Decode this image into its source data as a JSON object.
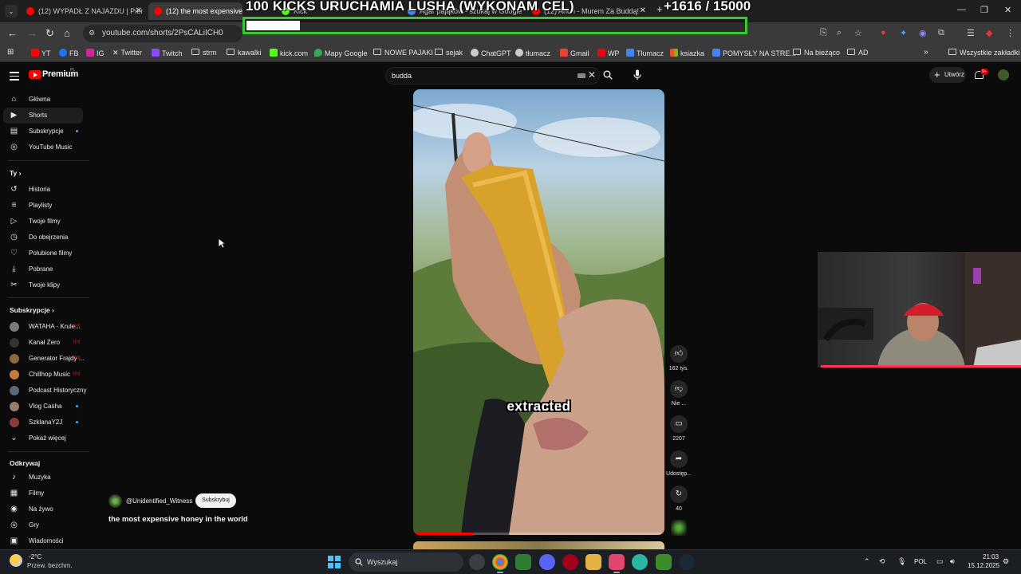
{
  "browser": {
    "tabs": [
      {
        "label": "(12) WYPADŁ Z NAJAZDU | Pier",
        "color": "#ff0000"
      },
      {
        "label": "(12) the most expensive ho",
        "color": "#ff0000",
        "active": true
      },
      {
        "label": "Kick",
        "color": "#53fc18"
      },
      {
        "label": "Agar pająków - szukaj w Google",
        "color": "#4285f4"
      },
      {
        "label": "(12) Anon - Murem Za Buddą!",
        "color": "#ff0000"
      }
    ],
    "url": "youtube.com/shorts/2PsCALiICH0",
    "bookmarks": [
      {
        "label": "YT",
        "icon": "youtube-icon",
        "color": "#ff0000"
      },
      {
        "label": "FB",
        "icon": "facebook-icon",
        "color": "#1877f2"
      },
      {
        "label": "IG",
        "icon": "instagram-icon",
        "color": "#d6249f"
      },
      {
        "label": "Twitter",
        "icon": "x-icon",
        "color": "#ffffff"
      },
      {
        "label": "Twitch",
        "icon": "twitch-icon",
        "color": "#9146ff"
      },
      {
        "label": "strm",
        "icon": "folder-icon"
      },
      {
        "label": "kawalki",
        "icon": "folder-icon"
      },
      {
        "label": "kick.com",
        "icon": "kick-icon",
        "color": "#53fc18"
      },
      {
        "label": "Mapy Google",
        "icon": "maps-icon",
        "color": "#34a853"
      },
      {
        "label": "NOWE PAJAKI",
        "icon": "folder-icon"
      },
      {
        "label": "sejak",
        "icon": "folder-icon"
      },
      {
        "label": "ChatGPT",
        "icon": "chatgpt-icon",
        "color": "#cccccc"
      },
      {
        "label": "tłumacz",
        "icon": "globe-icon",
        "color": "#cccccc"
      },
      {
        "label": "Gmail",
        "icon": "gmail-icon",
        "color": "#ea4335"
      },
      {
        "label": "WP",
        "icon": "wp-icon",
        "color": "#e30613"
      },
      {
        "label": "Tłumacz",
        "icon": "translate-icon",
        "color": "#4285f4"
      },
      {
        "label": "ksiazka",
        "icon": "ms-icon",
        "color": "#f25022"
      },
      {
        "label": "POMYSŁY NA STRE...",
        "icon": "doc-icon",
        "color": "#4285f4"
      },
      {
        "label": "Na bieżąco",
        "icon": "folder-icon"
      },
      {
        "label": "AD",
        "icon": "folder-icon"
      }
    ],
    "all_bookmarks": "Wszystkie zakładki"
  },
  "overlay": {
    "title": "100 KICKS URUCHAMIA LUSHA (WYKONAM CEL)",
    "counter": "+1616   / 15000",
    "progress": 0.108,
    "color": "#39c734"
  },
  "youtube": {
    "logo": "Premium",
    "logo_country": "PL",
    "search_value": "budda",
    "create": "Utwórz",
    "notifications_badge": "9+",
    "nav_main": [
      {
        "label": "Główna",
        "icon": "home-icon"
      },
      {
        "label": "Shorts",
        "icon": "shorts-icon",
        "active": true
      },
      {
        "label": "Subskrypcje",
        "icon": "subscriptions-icon",
        "dot": true
      },
      {
        "label": "YouTube Music",
        "icon": "music-icon"
      }
    ],
    "you_header": "Ty",
    "nav_you": [
      {
        "label": "Historia",
        "icon": "history-icon"
      },
      {
        "label": "Playlisty",
        "icon": "playlist-icon"
      },
      {
        "label": "Twoje filmy",
        "icon": "video-icon"
      },
      {
        "label": "Do obejrzenia",
        "icon": "clock-icon"
      },
      {
        "label": "Polubione filmy",
        "icon": "like-icon"
      },
      {
        "label": "Pobrane",
        "icon": "download-icon"
      },
      {
        "label": "Twoje klipy",
        "icon": "scissors-icon"
      }
    ],
    "subs_header": "Subskrypcje",
    "subscriptions": [
      {
        "label": "WATAHA - Krule...",
        "color": "#7a7a7a",
        "live": true
      },
      {
        "label": "Kanał Zero",
        "color": "#222222",
        "live": true
      },
      {
        "label": "Generator Frajdy ...",
        "color": "#8a6a3a",
        "live": true
      },
      {
        "label": "Chillhop Music",
        "color": "#c97a3a",
        "live": true
      },
      {
        "label": "Podcast Historyczny",
        "color": "#5a6a7a",
        "live": false
      },
      {
        "label": "Vlog Casha",
        "color": "#9a7a6a",
        "dot": true
      },
      {
        "label": "SzklanaY2J",
        "color": "#8a3a3a",
        "dot": true
      }
    ],
    "show_more": "Pokaż więcej",
    "explore_header": "Odkrywaj",
    "explore": [
      {
        "label": "Muzyka",
        "icon": "music-note-icon"
      },
      {
        "label": "Filmy",
        "icon": "film-icon"
      },
      {
        "label": "Na żywo",
        "icon": "live-icon"
      },
      {
        "label": "Gry",
        "icon": "gamepad-icon"
      },
      {
        "label": "Wiadomości",
        "icon": "news-icon"
      }
    ],
    "short": {
      "caption": "extracted",
      "channel": "@Unidentified_Witness",
      "subscribe": "Subskrybuj",
      "title": "the most expensive honey in the world",
      "progress": 0.24,
      "actions": [
        {
          "name": "like",
          "icon": "thumbs-up-icon",
          "label": "162 tys."
        },
        {
          "name": "dislike",
          "icon": "thumbs-down-icon",
          "label": "Nie ..."
        },
        {
          "name": "comments",
          "icon": "comment-icon",
          "label": "2207"
        },
        {
          "name": "share",
          "icon": "share-icon",
          "label": "Udostęp..."
        },
        {
          "name": "remix",
          "icon": "remix-icon",
          "label": "40"
        }
      ]
    }
  },
  "taskbar": {
    "weather_temp": "-2°C",
    "weather_desc": "Przew. bezchm.",
    "search": "Wyszukaj",
    "language": "POL",
    "time": "21:03",
    "date": "15.12.2025"
  }
}
